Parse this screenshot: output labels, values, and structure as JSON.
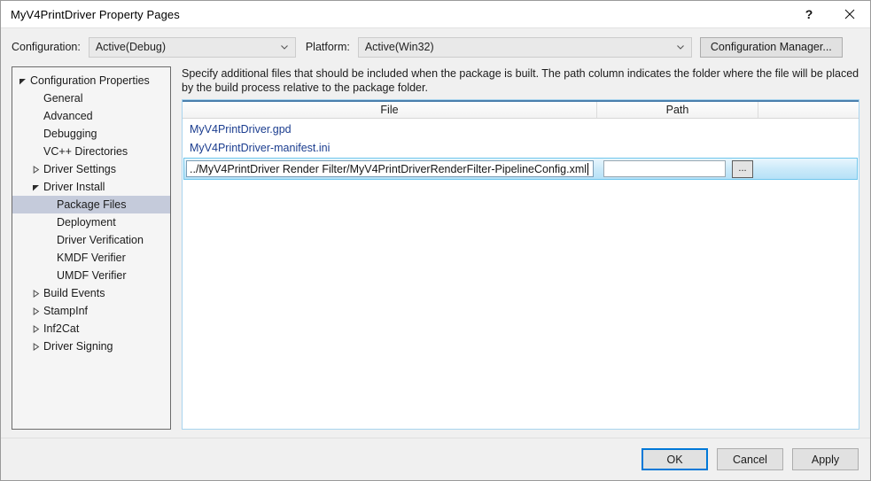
{
  "window": {
    "title": "MyV4PrintDriver Property Pages",
    "help_label": "?",
    "close_label": "✕"
  },
  "configbar": {
    "configuration_label": "Configuration:",
    "configuration_value": "Active(Debug)",
    "platform_label": "Platform:",
    "platform_value": "Active(Win32)",
    "config_manager_label": "Configuration Manager..."
  },
  "tree": {
    "items": [
      {
        "label": "Configuration Properties",
        "level": 0,
        "expander": "expanded",
        "selected": false
      },
      {
        "label": "General",
        "level": 1,
        "expander": "none",
        "selected": false
      },
      {
        "label": "Advanced",
        "level": 1,
        "expander": "none",
        "selected": false
      },
      {
        "label": "Debugging",
        "level": 1,
        "expander": "none",
        "selected": false
      },
      {
        "label": "VC++ Directories",
        "level": 1,
        "expander": "none",
        "selected": false
      },
      {
        "label": "Driver Settings",
        "level": 1,
        "expander": "collapsed",
        "selected": false
      },
      {
        "label": "Driver Install",
        "level": 1,
        "expander": "expanded",
        "selected": false
      },
      {
        "label": "Package Files",
        "level": 2,
        "expander": "none",
        "selected": true
      },
      {
        "label": "Deployment",
        "level": 2,
        "expander": "none",
        "selected": false
      },
      {
        "label": "Driver Verification",
        "level": 2,
        "expander": "none",
        "selected": false
      },
      {
        "label": "KMDF Verifier",
        "level": 2,
        "expander": "none",
        "selected": false
      },
      {
        "label": "UMDF Verifier",
        "level": 2,
        "expander": "none",
        "selected": false
      },
      {
        "label": "Build Events",
        "level": 1,
        "expander": "collapsed",
        "selected": false
      },
      {
        "label": "StampInf",
        "level": 1,
        "expander": "collapsed",
        "selected": false
      },
      {
        "label": "Inf2Cat",
        "level": 1,
        "expander": "collapsed",
        "selected": false
      },
      {
        "label": "Driver Signing",
        "level": 1,
        "expander": "collapsed",
        "selected": false
      }
    ]
  },
  "main": {
    "description": "Specify additional files that should be included when the package is built.  The path column indicates the folder where the file will be placed by the build process relative to the package folder.",
    "columns": {
      "file": "File",
      "path": "Path",
      "extra": ""
    },
    "rows": [
      {
        "file": "MyV4PrintDriver.gpd",
        "path": ""
      },
      {
        "file": "MyV4PrintDriver-manifest.ini",
        "path": ""
      }
    ],
    "editing_row": {
      "file_value": "../MyV4PrintDriver Render Filter/MyV4PrintDriverRenderFilter-PipelineConfig.xml",
      "file_placeholder": "",
      "path_value": "",
      "path_placeholder": "",
      "browse_label": "..."
    }
  },
  "footer": {
    "ok_label": "OK",
    "cancel_label": "Cancel",
    "apply_label": "Apply"
  },
  "colors": {
    "link": "#1b3d8f",
    "selection": "#c5cbdb",
    "accent": "#0078d7",
    "edit_row_border": "#6fc6ec",
    "header_rule": "#4a7fad"
  }
}
